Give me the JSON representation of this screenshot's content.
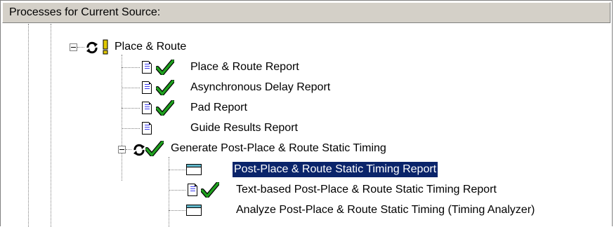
{
  "header": {
    "title": "Processes for Current Source:"
  },
  "tree": {
    "place_route": {
      "label": "Place & Route",
      "icons": [
        "refresh-icon",
        "warning-exclamation-icon"
      ]
    },
    "children": [
      {
        "label": "Place & Route Report",
        "icons": [
          "document-icon",
          "checkmark-icon"
        ]
      },
      {
        "label": "Asynchronous Delay Report",
        "icons": [
          "document-icon",
          "checkmark-icon"
        ]
      },
      {
        "label": "Pad Report",
        "icons": [
          "document-icon",
          "checkmark-icon"
        ]
      },
      {
        "label": "Guide Results Report",
        "icons": [
          "document-icon"
        ]
      },
      {
        "label": "Generate Post-Place & Route Static Timing",
        "icons": [
          "refresh-icon",
          "checkmark-icon"
        ]
      }
    ],
    "timing_children": [
      {
        "label": "Post-Place & Route Static Timing Report",
        "icons": [
          "window-icon"
        ],
        "selected": true
      },
      {
        "label": "Text-based Post-Place & Route Static Timing Report",
        "icons": [
          "document-icon",
          "checkmark-icon"
        ]
      },
      {
        "label": "Analyze Post-Place & Route Static Timing (Timing Analyzer)",
        "icons": [
          "window-icon"
        ]
      }
    ]
  },
  "colors": {
    "selection": "#0a246a",
    "check": "#1fa01f",
    "warning": "#e0c800",
    "header_bg": "#d4d0c8"
  }
}
